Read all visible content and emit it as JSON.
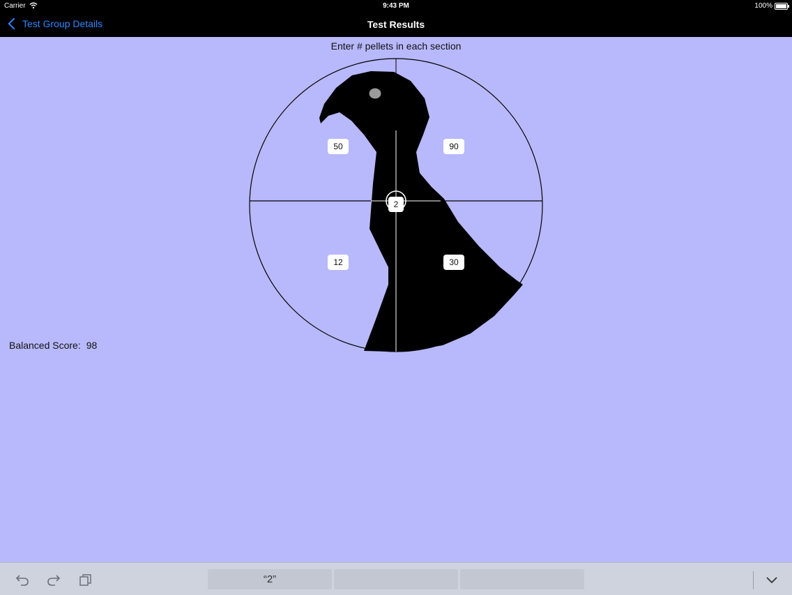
{
  "status": {
    "carrier": "Carrier",
    "time": "9:43 PM",
    "battery": "100%"
  },
  "nav": {
    "back_label": "Test Group Details",
    "title": "Test Results"
  },
  "instructions": "Enter # pellets in each section",
  "sections": {
    "top_left": "50",
    "top_right": "90",
    "bottom_left": "12",
    "bottom_right": "30",
    "center": "2"
  },
  "score": {
    "label": "Balanced Score:",
    "value": "98"
  },
  "keyboard": {
    "suggestion_1": "“2”",
    "suggestion_2": "",
    "suggestion_3": ""
  },
  "colors": {
    "background": "#b8b8fc",
    "bar": "#000000",
    "link": "#2f86ff"
  }
}
